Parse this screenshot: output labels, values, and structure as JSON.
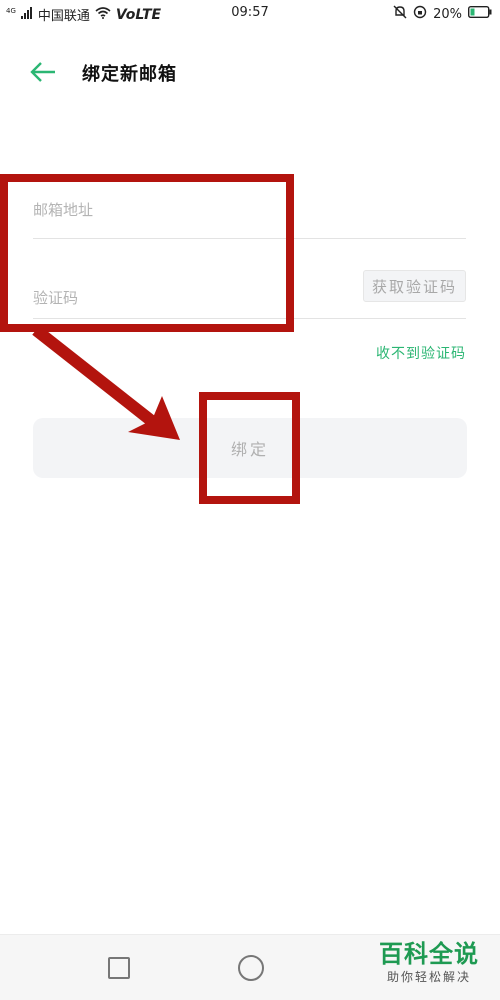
{
  "status_bar": {
    "network_type": "4G",
    "carrier": "中国联通",
    "volte": "VoLTE",
    "time": "09:57",
    "battery": "20%"
  },
  "header": {
    "back_icon": "arrow-left-icon",
    "title": "绑定新邮箱"
  },
  "form": {
    "email_placeholder": "邮箱地址",
    "code_placeholder": "验证码",
    "get_code_label": "获取验证码",
    "no_code_link": "收不到验证码",
    "bind_label": "绑定"
  },
  "nav_bar": {
    "recent_icon": "square-icon",
    "home_icon": "circle-icon"
  },
  "watermark": {
    "title": "百科全说",
    "subtitle": "助你轻松解决"
  },
  "colors": {
    "accent": "#2bb673",
    "annotation": "#b3140e",
    "button_bg": "#f3f4f6"
  }
}
